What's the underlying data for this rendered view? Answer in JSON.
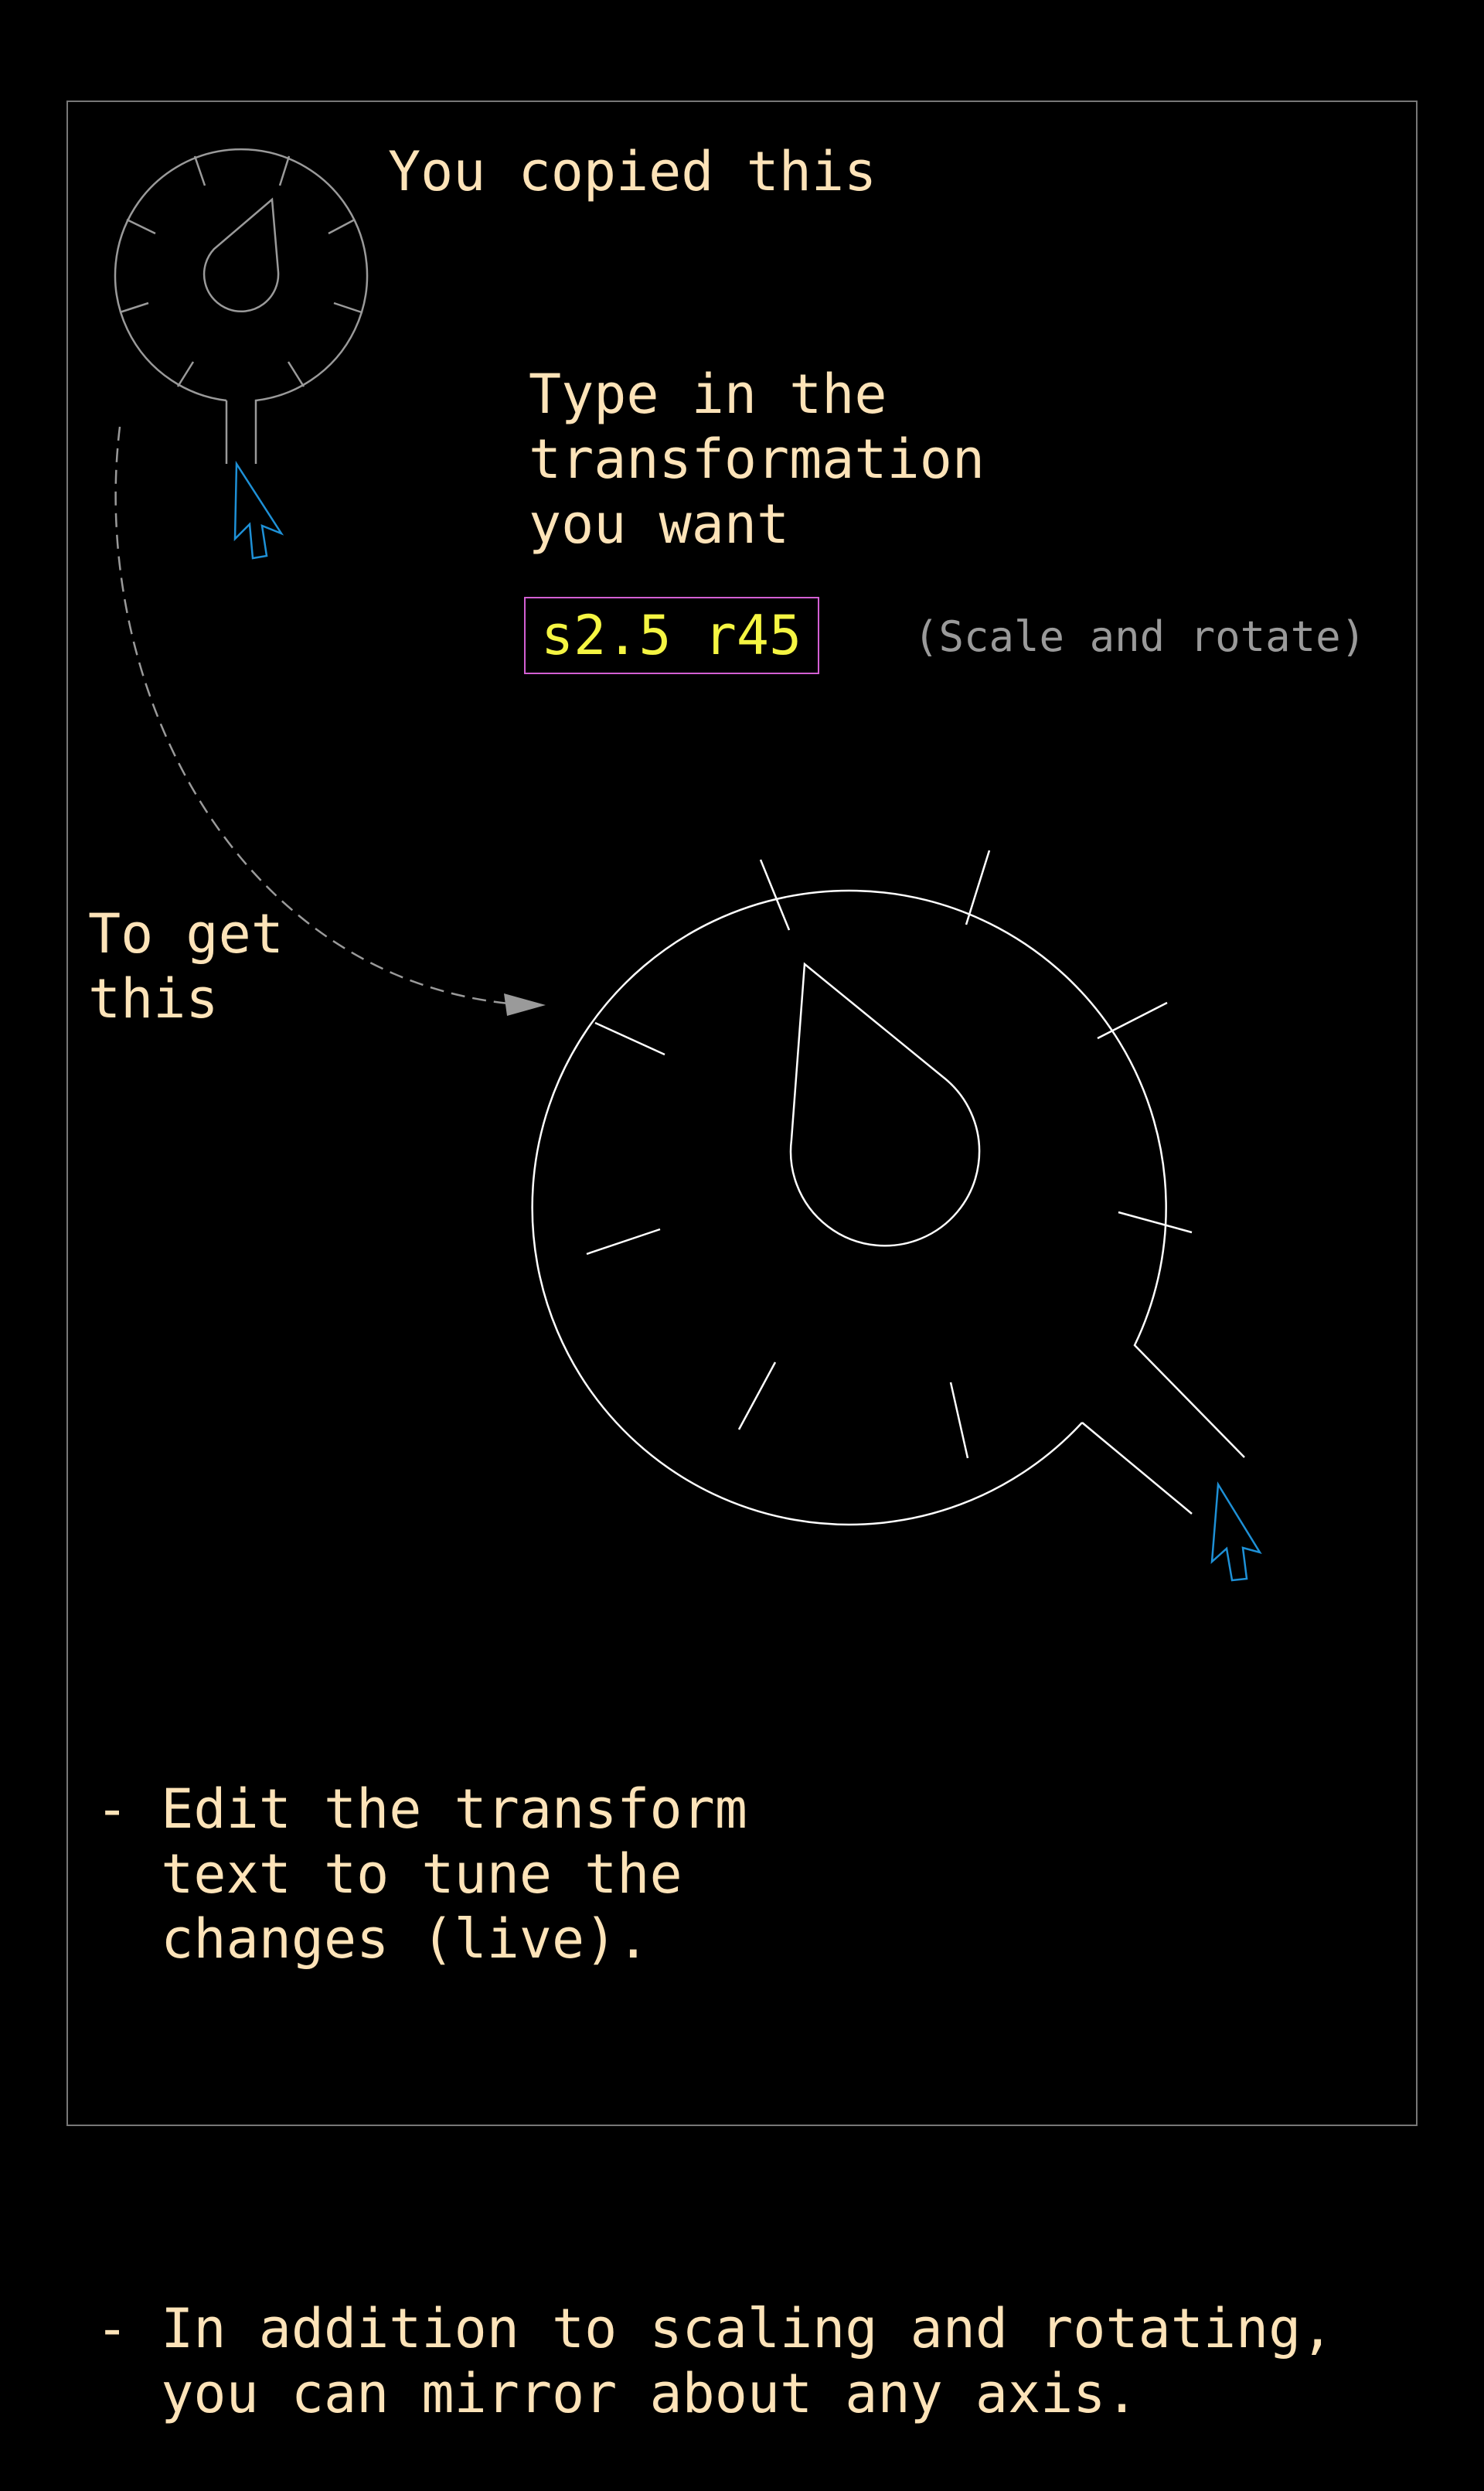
{
  "labels": {
    "copied": "You copied this",
    "instruction": "Type in the\ntransformation\nyou want",
    "transform_text": "s2.5 r45",
    "transform_hint": "(Scale and rotate)",
    "result": "To get\nthis",
    "tips": [
      "- Edit the transform\n  text to tune the\n  changes (live).",
      "- In addition to scaling and rotating,\n  you can mirror about any axis."
    ]
  },
  "colors": {
    "background": "#000000",
    "frame": "#777777",
    "text": "#fde3b8",
    "input_text": "#f5f542",
    "input_border": "#d35fd3",
    "hint": "#9a9a9a",
    "cursor": "#1e90d6",
    "small_gauge": "#9a9a9a",
    "large_gauge": "#ffffff",
    "arrow": "#9a9a9a"
  },
  "icons": {
    "source_cursor": "mouse-pointer-icon",
    "result_cursor": "mouse-pointer-icon"
  }
}
